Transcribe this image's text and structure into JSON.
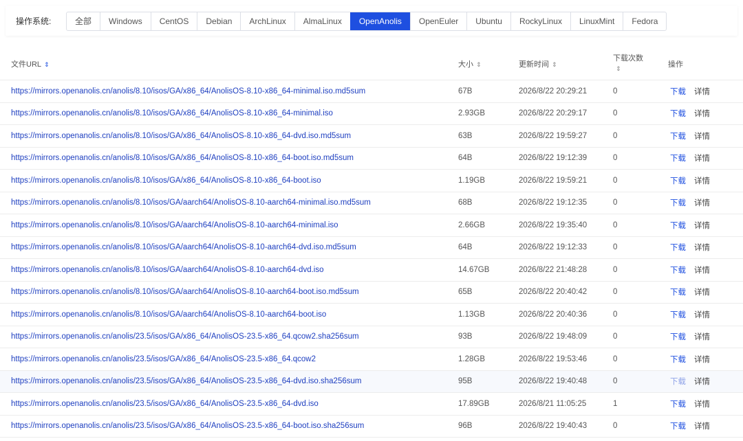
{
  "filter": {
    "label": "操作系统:",
    "options": [
      "全部",
      "Windows",
      "CentOS",
      "Debian",
      "ArchLinux",
      "AlmaLinux",
      "OpenAnolis",
      "OpenEuler",
      "Ubuntu",
      "RockyLinux",
      "LinuxMint",
      "Fedora"
    ],
    "selected": "OpenAnolis"
  },
  "table": {
    "headers": {
      "url": "文件URL",
      "size": "大小",
      "time": "更新时间",
      "count": "下载次数",
      "action": "操作"
    },
    "sort_icon": "⇕",
    "download_label": "下载",
    "detail_label": "详情",
    "rows": [
      {
        "url": "https://mirrors.openanolis.cn/anolis/8.10/isos/GA/x86_64/AnolisOS-8.10-x86_64-minimal.iso.md5sum",
        "size": "67B",
        "time": "2026/8/22 20:29:21",
        "count": "0"
      },
      {
        "url": "https://mirrors.openanolis.cn/anolis/8.10/isos/GA/x86_64/AnolisOS-8.10-x86_64-minimal.iso",
        "size": "2.93GB",
        "time": "2026/8/22 20:29:17",
        "count": "0"
      },
      {
        "url": "https://mirrors.openanolis.cn/anolis/8.10/isos/GA/x86_64/AnolisOS-8.10-x86_64-dvd.iso.md5sum",
        "size": "63B",
        "time": "2026/8/22 19:59:27",
        "count": "0"
      },
      {
        "url": "https://mirrors.openanolis.cn/anolis/8.10/isos/GA/x86_64/AnolisOS-8.10-x86_64-boot.iso.md5sum",
        "size": "64B",
        "time": "2026/8/22 19:12:39",
        "count": "0"
      },
      {
        "url": "https://mirrors.openanolis.cn/anolis/8.10/isos/GA/x86_64/AnolisOS-8.10-x86_64-boot.iso",
        "size": "1.19GB",
        "time": "2026/8/22 19:59:21",
        "count": "0"
      },
      {
        "url": "https://mirrors.openanolis.cn/anolis/8.10/isos/GA/aarch64/AnolisOS-8.10-aarch64-minimal.iso.md5sum",
        "size": "68B",
        "time": "2026/8/22 19:12:35",
        "count": "0"
      },
      {
        "url": "https://mirrors.openanolis.cn/anolis/8.10/isos/GA/aarch64/AnolisOS-8.10-aarch64-minimal.iso",
        "size": "2.66GB",
        "time": "2026/8/22 19:35:40",
        "count": "0"
      },
      {
        "url": "https://mirrors.openanolis.cn/anolis/8.10/isos/GA/aarch64/AnolisOS-8.10-aarch64-dvd.iso.md5sum",
        "size": "64B",
        "time": "2026/8/22 19:12:33",
        "count": "0"
      },
      {
        "url": "https://mirrors.openanolis.cn/anolis/8.10/isos/GA/aarch64/AnolisOS-8.10-aarch64-dvd.iso",
        "size": "14.67GB",
        "time": "2026/8/22 21:48:28",
        "count": "0"
      },
      {
        "url": "https://mirrors.openanolis.cn/anolis/8.10/isos/GA/aarch64/AnolisOS-8.10-aarch64-boot.iso.md5sum",
        "size": "65B",
        "time": "2026/8/22 20:40:42",
        "count": "0"
      },
      {
        "url": "https://mirrors.openanolis.cn/anolis/8.10/isos/GA/aarch64/AnolisOS-8.10-aarch64-boot.iso",
        "size": "1.13GB",
        "time": "2026/8/22 20:40:36",
        "count": "0"
      },
      {
        "url": "https://mirrors.openanolis.cn/anolis/23.5/isos/GA/x86_64/AnolisOS-23.5-x86_64.qcow2.sha256sum",
        "size": "93B",
        "time": "2026/8/22 19:48:09",
        "count": "0"
      },
      {
        "url": "https://mirrors.openanolis.cn/anolis/23.5/isos/GA/x86_64/AnolisOS-23.5-x86_64.qcow2",
        "size": "1.28GB",
        "time": "2026/8/22 19:53:46",
        "count": "0"
      },
      {
        "url": "https://mirrors.openanolis.cn/anolis/23.5/isos/GA/x86_64/AnolisOS-23.5-x86_64-dvd.iso.sha256sum",
        "size": "95B",
        "time": "2026/8/22 19:40:48",
        "count": "0",
        "hover": true
      },
      {
        "url": "https://mirrors.openanolis.cn/anolis/23.5/isos/GA/x86_64/AnolisOS-23.5-x86_64-dvd.iso",
        "size": "17.89GB",
        "time": "2026/8/21 11:05:25",
        "count": "1"
      },
      {
        "url": "https://mirrors.openanolis.cn/anolis/23.5/isos/GA/x86_64/AnolisOS-23.5-x86_64-boot.iso.sha256sum",
        "size": "96B",
        "time": "2026/8/22 19:40:43",
        "count": "0"
      }
    ]
  }
}
